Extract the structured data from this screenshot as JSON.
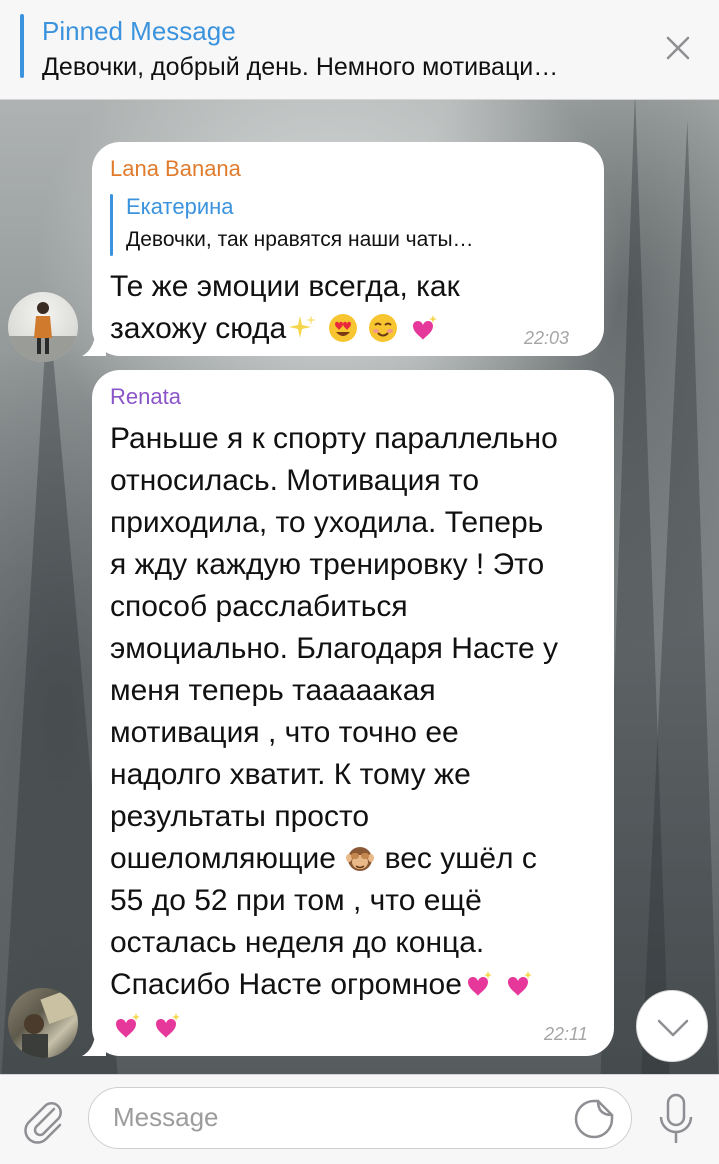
{
  "pinned": {
    "title": "Pinned Message",
    "text": "Девочки, добрый день.  Немного мотиваци…",
    "close_icon": "close-icon"
  },
  "messages": [
    {
      "sender": "Lana Banana",
      "sender_color": "#e07b2d",
      "reply": {
        "name": "Екатерина",
        "text": "Девочки, так нравятся наши чаты…"
      },
      "text_line1": "Те же эмоции всегда, как",
      "text_line2": "захожу сюда",
      "emojis": [
        "sparkles",
        "heart-eyes",
        "smiling-blush",
        "sparkling-heart"
      ],
      "time": "22:03"
    },
    {
      "sender": "Renata",
      "sender_color": "#8b55c9",
      "lines": [
        "Раньше я к спорту параллельно",
        "относилась. Мотивация то",
        "приходила, то уходила. Теперь",
        "я жду каждую тренировку ! Это",
        "способ расслабиться",
        "эмоциально. Благодаря Насте у",
        "меня теперь тааааакая",
        "мотивация , что точно ее",
        "надолго хватит. К тому же",
        "результаты просто"
      ],
      "line_with_emoji_a": "ошеломляющие",
      "line_with_emoji_b": " вес ушёл с",
      "lines_after": [
        "55 до 52 при том , что ещё",
        "осталась неделя до конца."
      ],
      "last_line": "Спасибо Насте огромное",
      "time": "22:11"
    }
  ],
  "input": {
    "placeholder": "Message"
  },
  "colors": {
    "accent": "#3b93de",
    "bubble": "#ffffff"
  }
}
